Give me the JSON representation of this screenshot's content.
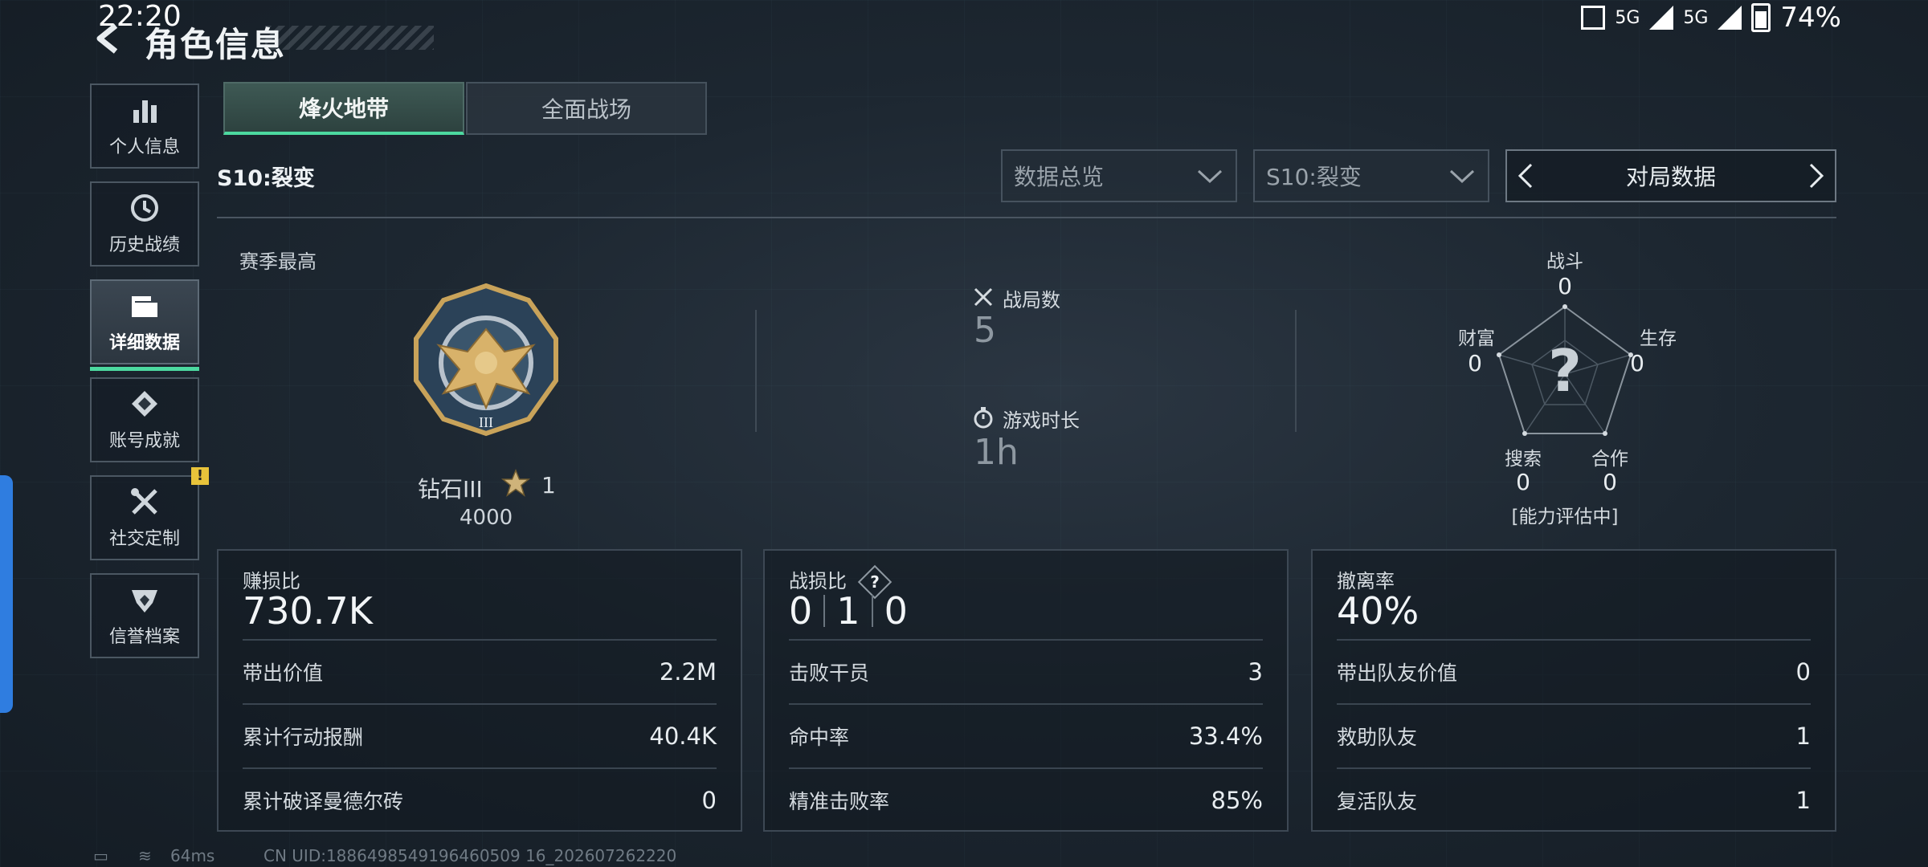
{
  "status_bar": {
    "time": "22:20",
    "net1": "5G",
    "net2": "5G",
    "battery": "74%"
  },
  "header": {
    "title": "角色信息"
  },
  "sidebar": {
    "items": [
      {
        "label": "个人信息",
        "icon": "bar-chart-icon"
      },
      {
        "label": "历史战绩",
        "icon": "clock-icon"
      },
      {
        "label": "详细数据",
        "icon": "folder-icon",
        "active": true
      },
      {
        "label": "账号成就",
        "icon": "achievement-icon"
      },
      {
        "label": "社交定制",
        "icon": "tools-icon",
        "badge": "!"
      },
      {
        "label": "信誉档案",
        "icon": "shield-icon"
      }
    ]
  },
  "tabs": [
    {
      "label": "烽火地带",
      "active": true
    },
    {
      "label": "全面战场"
    }
  ],
  "season_label": "S10:裂变",
  "filters": {
    "overview": "数据总览",
    "season": "S10:裂变",
    "pager_label": "对局数据"
  },
  "season_best": {
    "label": "赛季最高",
    "rank": "钻石III",
    "stars": "1",
    "score": "4000"
  },
  "match_stats": {
    "matches_label": "战局数",
    "matches_value": "5",
    "playtime_label": "游戏时长",
    "playtime_value": "1h"
  },
  "radar": {
    "combat_label": "战斗",
    "combat_value": "0",
    "survival_label": "生存",
    "survival_value": "0",
    "cooperation_label": "合作",
    "cooperation_value": "0",
    "search_label": "搜索",
    "search_value": "0",
    "wealth_label": "财富",
    "wealth_value": "0",
    "center_mark": "?",
    "status": "[能力评估中]"
  },
  "panels": {
    "profit": {
      "label": "赚损比",
      "value": "730.7K",
      "rows": [
        {
          "k": "带出价值",
          "v": "2.2M"
        },
        {
          "k": "累计行动报酬",
          "v": "40.4K"
        },
        {
          "k": "累计破译曼德尔砖",
          "v": "0"
        }
      ]
    },
    "combat": {
      "label": "战损比",
      "help": "?",
      "ratio": [
        "0",
        "1",
        "0"
      ],
      "rows": [
        {
          "k": "击败干员",
          "v": "3"
        },
        {
          "k": "命中率",
          "v": "33.4%"
        },
        {
          "k": "精准击败率",
          "v": "85%"
        }
      ]
    },
    "extract": {
      "label": "撤离率",
      "value": "40%",
      "rows": [
        {
          "k": "带出队友价值",
          "v": "0"
        },
        {
          "k": "救助队友",
          "v": "1"
        },
        {
          "k": "复活队友",
          "v": "1"
        }
      ]
    }
  },
  "footer": {
    "ping": "64ms",
    "uid": "CN UID:1886498549196460509 16_202607262220"
  },
  "colors": {
    "accent": "#4cd9a0",
    "badge": "#e8c33a",
    "edge": "#2f7de0"
  }
}
